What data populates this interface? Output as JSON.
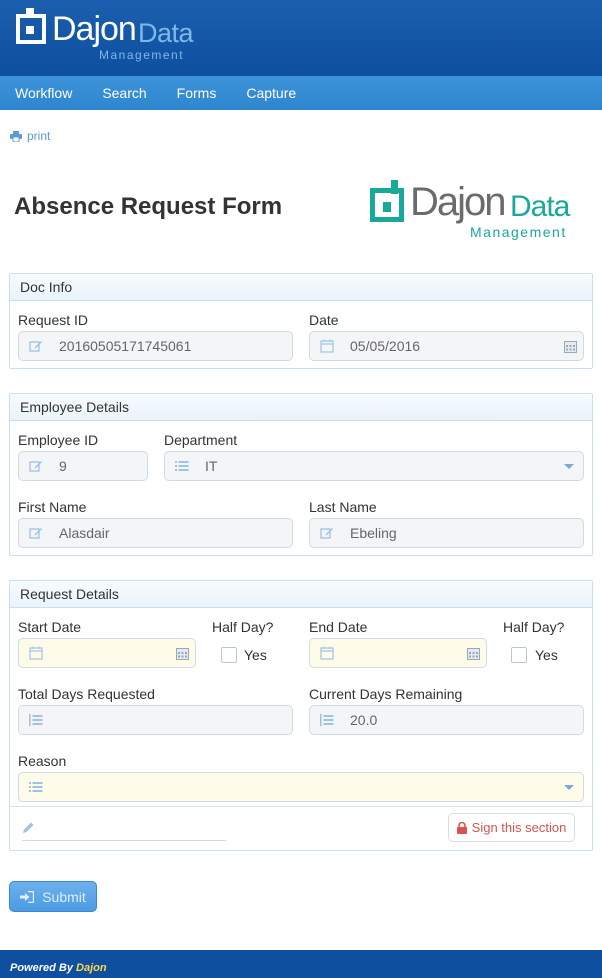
{
  "header": {
    "logo_main": "Dajon",
    "logo_accent": "Data",
    "logo_sub": "Management"
  },
  "nav": {
    "items": [
      {
        "label": "Workflow"
      },
      {
        "label": "Search"
      },
      {
        "label": "Forms"
      },
      {
        "label": "Capture"
      }
    ]
  },
  "toolbar": {
    "print_label": "print"
  },
  "form": {
    "title": "Absence Request Form",
    "brand_main": "Dajon",
    "brand_accent": "Data",
    "brand_sub": "Management"
  },
  "doc_info": {
    "heading": "Doc Info",
    "request_id_label": "Request ID",
    "request_id_value": "20160505171745061",
    "date_label": "Date",
    "date_value": "05/05/2016"
  },
  "employee": {
    "heading": "Employee Details",
    "employee_id_label": "Employee ID",
    "employee_id_value": "9",
    "department_label": "Department",
    "department_value": "IT",
    "first_name_label": "First Name",
    "first_name_value": "Alasdair",
    "last_name_label": "Last Name",
    "last_name_value": "Ebeling"
  },
  "request": {
    "heading": "Request Details",
    "start_date_label": "Start Date",
    "start_date_value": "",
    "half_day_label": "Half Day?",
    "yes_label": "Yes",
    "end_date_label": "End Date",
    "end_date_value": "",
    "end_half_day_label": "Half Day?",
    "end_yes_label": "Yes",
    "total_days_label": "Total Days Requested",
    "total_days_value": "",
    "remaining_label": "Current Days Remaining",
    "remaining_value": "20.0",
    "reason_label": "Reason",
    "reason_value": "",
    "sign_label": "Sign this section"
  },
  "actions": {
    "submit_label": "Submit"
  },
  "footer": {
    "powered_label": "Powered By",
    "powered_brand": "Dajon"
  },
  "colors": {
    "header_bg": "#0e4f9f",
    "nav_bg": "#3d93d8",
    "brand_teal": "#18a99a",
    "sign_red": "#d9534f",
    "required_yellow": "#fefbe8"
  }
}
